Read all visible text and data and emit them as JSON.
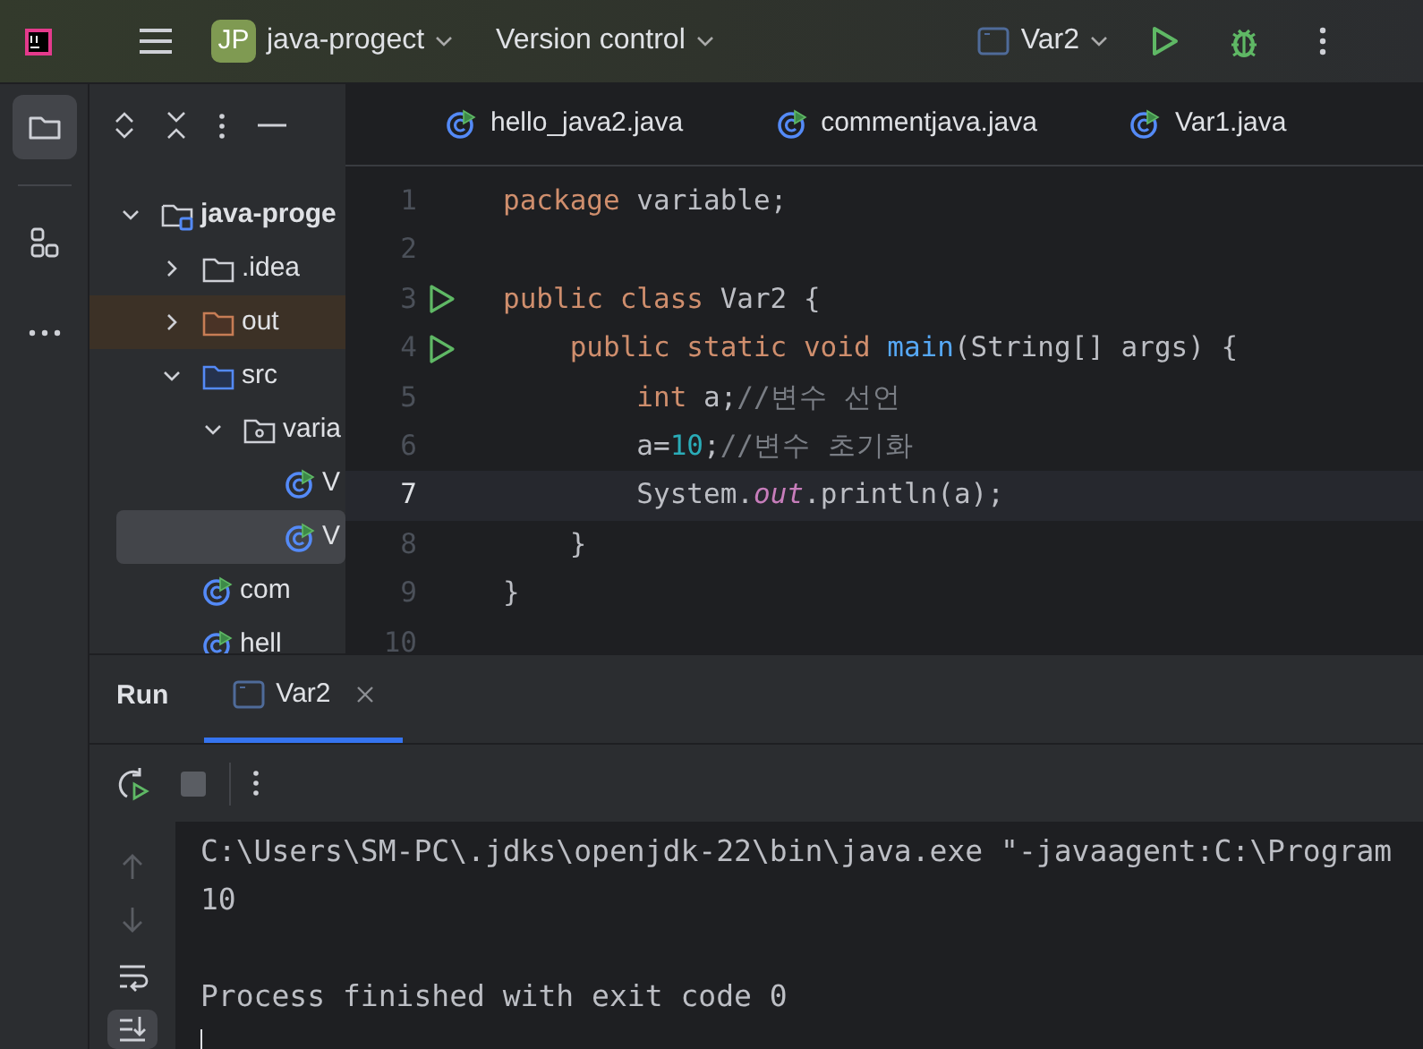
{
  "toolbar": {
    "project_badge": "JP",
    "project": "java-progect",
    "vcs": "Version control",
    "run_config": "Var2"
  },
  "tool_strip": [
    {
      "kind": "project",
      "selected": true
    },
    {
      "kind": "structure",
      "selected": false
    },
    {
      "kind": "more",
      "selected": false
    }
  ],
  "project_tree": [
    {
      "label": "java-proge",
      "kind": "project",
      "expanded": true,
      "selected": false,
      "children": [
        {
          "label": ".idea",
          "kind": "folder",
          "expanded": false,
          "selected": false
        },
        {
          "label": "out",
          "kind": "excluded",
          "expanded": false,
          "selected": false
        },
        {
          "label": "src",
          "kind": "source",
          "expanded": true,
          "selected": false,
          "children": [
            {
              "label": "varia",
              "kind": "package",
              "expanded": true,
              "selected": false,
              "children": [
                {
                  "label": "V",
                  "kind": "class",
                  "selected": false
                },
                {
                  "label": "V",
                  "kind": "class",
                  "selected": true
                }
              ]
            }
          ]
        },
        {
          "label": "com",
          "kind": "class",
          "selected": false
        },
        {
          "label": "hell",
          "kind": "class",
          "selected": false
        }
      ]
    }
  ],
  "editor": {
    "tabs": [
      {
        "label": "hello_java2.java"
      },
      {
        "label": "commentjava.java"
      },
      {
        "label": "Var1.java"
      }
    ],
    "lines": [
      {
        "number": "1",
        "run_marker": false,
        "current": false,
        "tokens": [
          {
            "text": "package",
            "kind": "keyword"
          },
          {
            "text": " variable;",
            "kind": "plain"
          }
        ]
      },
      {
        "number": "2",
        "run_marker": false,
        "current": false
      },
      {
        "number": "3",
        "run_marker": true,
        "current": false,
        "tokens": [
          {
            "text": "public class",
            "kind": "keyword"
          },
          {
            "text": " Var2 {",
            "kind": "plain"
          }
        ]
      },
      {
        "number": "4",
        "run_marker": true,
        "current": false,
        "tokens": [
          {
            "text": "    public static void ",
            "kind": "keyword"
          },
          {
            "text": "main",
            "kind": "method"
          },
          {
            "text": "(String[] args) {",
            "kind": "plain"
          }
        ]
      },
      {
        "number": "5",
        "run_marker": false,
        "current": false,
        "tokens": [
          {
            "text": "        int",
            "kind": "keyword"
          },
          {
            "text": " a;",
            "kind": "plain"
          },
          {
            "text": "//변수 선언",
            "kind": "comment"
          }
        ]
      },
      {
        "number": "6",
        "run_marker": false,
        "current": false,
        "tokens": [
          {
            "text": "        a=",
            "kind": "plain"
          },
          {
            "text": "10",
            "kind": "number"
          },
          {
            "text": ";",
            "kind": "plain"
          },
          {
            "text": "//변수 초기화",
            "kind": "comment"
          }
        ]
      },
      {
        "number": "7",
        "run_marker": false,
        "current": true,
        "tokens": [
          {
            "text": "        System.",
            "kind": "plain"
          },
          {
            "text": "out",
            "kind": "field"
          },
          {
            "text": ".println(a);",
            "kind": "plain"
          }
        ]
      },
      {
        "number": "8",
        "run_marker": false,
        "current": false,
        "tokens": [
          {
            "text": "    }",
            "kind": "plain"
          }
        ]
      },
      {
        "number": "9",
        "run_marker": false,
        "current": false,
        "tokens": [
          {
            "text": "}",
            "kind": "plain"
          }
        ]
      },
      {
        "number": "10",
        "run_marker": false,
        "current": false
      }
    ]
  },
  "run_panel": {
    "title": "Run",
    "tabs": [
      {
        "label": "Var2",
        "selected": true
      }
    ],
    "actions": [
      {
        "kind": "rerun",
        "disabled": false
      },
      {
        "kind": "stop",
        "disabled": true
      }
    ],
    "side_actions": [
      {
        "kind": "up",
        "disabled": true,
        "selected": false
      },
      {
        "kind": "down",
        "disabled": true,
        "selected": false
      },
      {
        "kind": "wrap",
        "disabled": false,
        "selected": false
      },
      {
        "kind": "scroll_end",
        "disabled": false,
        "selected": true
      }
    ],
    "console": [
      {
        "text": "C:\\Users\\SM-PC\\.jdks\\openjdk-22\\bin\\java.exe \"-javaagent:C:\\Program",
        "gap_before": false
      },
      {
        "text": "10",
        "gap_before": false
      },
      {
        "text": "Process finished with exit code 0",
        "gap_before": true
      }
    ]
  }
}
